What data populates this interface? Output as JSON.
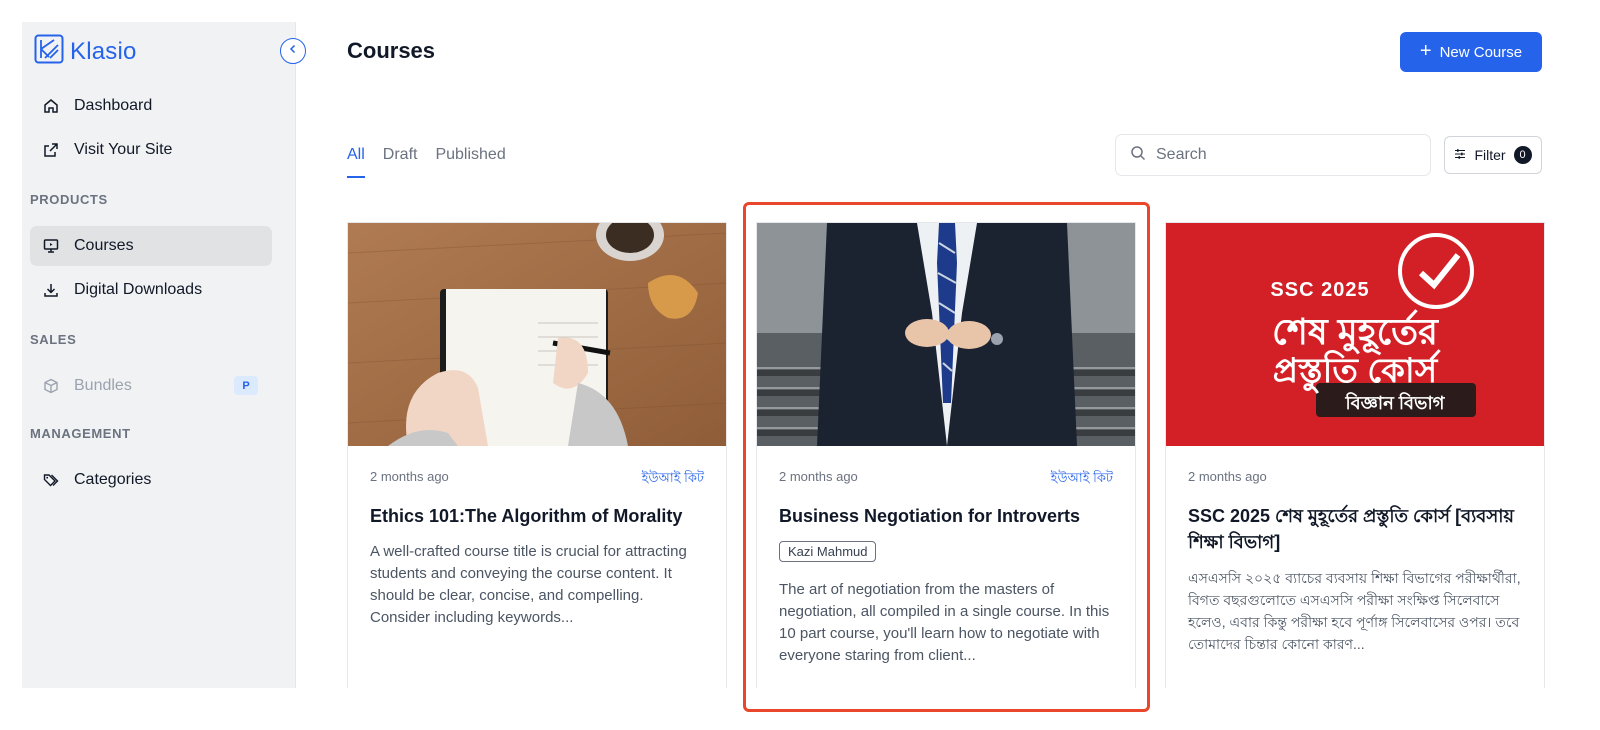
{
  "app": {
    "name": "Klasio",
    "brand_color": "#2563eb"
  },
  "sidebar": {
    "nav": [
      {
        "label": "Dashboard",
        "icon": "home-icon"
      },
      {
        "label": "Visit Your Site",
        "icon": "external-link-icon"
      }
    ],
    "sections": [
      {
        "title": "PRODUCTS",
        "items": [
          {
            "label": "Courses",
            "icon": "monitor-icon",
            "active": true
          },
          {
            "label": "Digital Downloads",
            "icon": "download-icon"
          }
        ]
      },
      {
        "title": "SALES",
        "items": [
          {
            "label": "Bundles",
            "icon": "box-icon",
            "disabled": true,
            "badge": "P"
          }
        ]
      },
      {
        "title": "MANAGEMENT",
        "items": [
          {
            "label": "Categories",
            "icon": "tags-icon"
          }
        ]
      }
    ]
  },
  "header": {
    "title": "Courses",
    "new_button": "New Course"
  },
  "tabs": [
    {
      "label": "All",
      "active": true
    },
    {
      "label": "Draft"
    },
    {
      "label": "Published"
    }
  ],
  "search": {
    "placeholder": "Search",
    "value": ""
  },
  "filter": {
    "label": "Filter",
    "count": "0"
  },
  "courses": [
    {
      "time": "2 months ago",
      "tag": "ইউআই কিট",
      "title": "Ethics 101:The Algorithm of Morality",
      "description": "A well-crafted course title is crucial for attracting students and conveying the course content. It should be clear, concise, and compelling. Consider including keywords..."
    },
    {
      "time": "2 months ago",
      "tag": "ইউআই কিট",
      "title": "Business Negotiation for Introverts",
      "author": "Kazi Mahmud",
      "description": "The art of negotiation from the masters of negotiation, all compiled in a single course. In this 10 part course, you'll learn how to negotiate with everyone staring from client..."
    },
    {
      "time": "2 months ago",
      "tag": "",
      "title": "SSC 2025 শেষ মুহূর্তের প্রস্তুতি কোর্স [ব্যবসায় শিক্ষা বিভাগ]",
      "description": "এসএসসি ২০২৫ ব্যাচের ব্যবসায় শিক্ষা বিভাগের পরীক্ষার্থীরা, বিগত বছরগুলোতে এসএসসি পরীক্ষা সংক্ষিপ্ত সিলেবাসে হলেও, এবার কিন্তু পরীক্ষা হবে পূর্ণাঙ্গ সিলেবাসের ওপর। তবে তোমাদের চিন্তার কোনো কারণ...",
      "poster": {
        "line1": "SSC 2025",
        "line2": "শেষ মুহূর্তের",
        "line3": "প্রস্তুতি কোর্স",
        "line4": "বিজ্ঞান বিভাগ"
      }
    }
  ]
}
